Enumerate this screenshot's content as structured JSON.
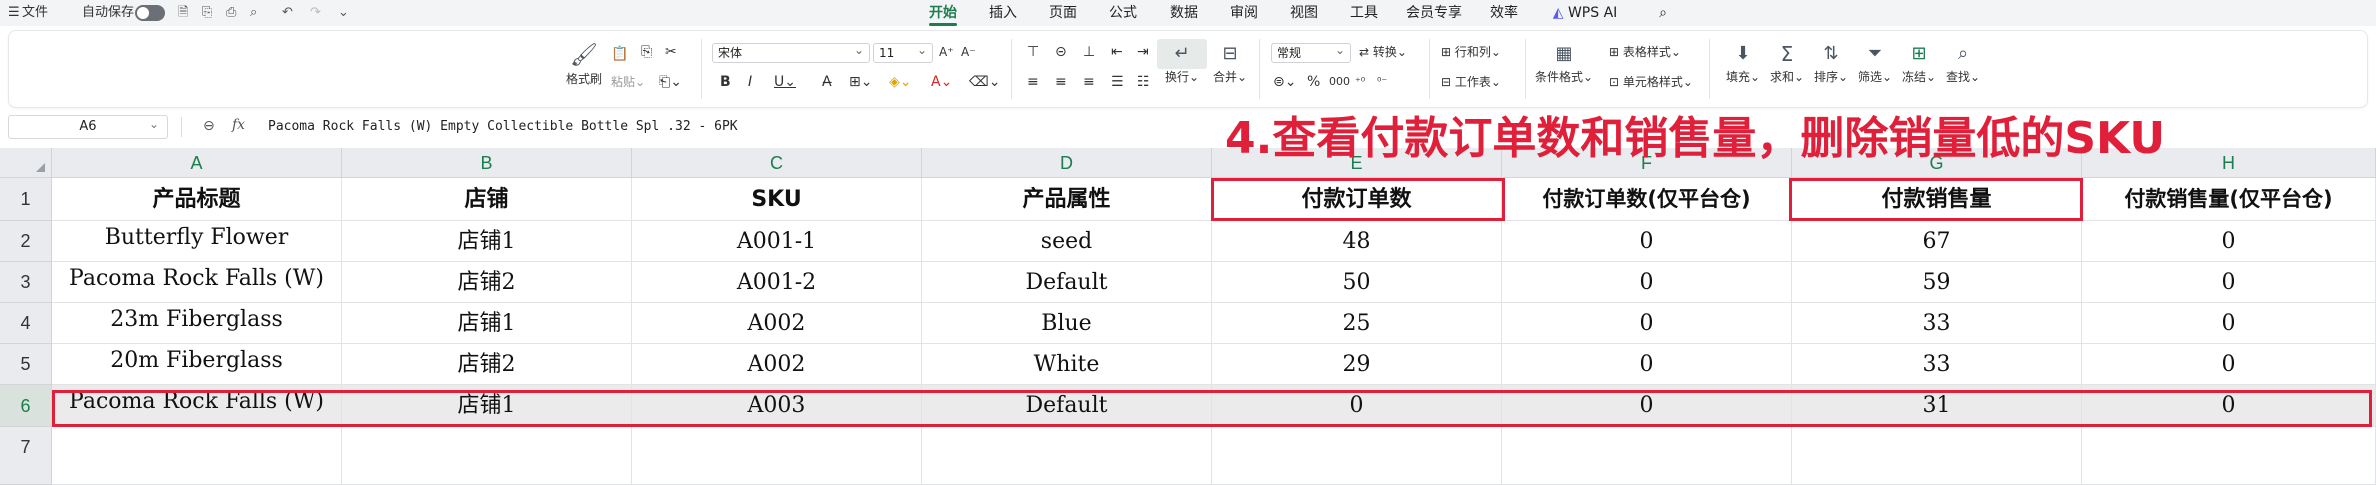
{
  "menubar": {
    "menu_icon": "hamburger-icon",
    "file_label": "文件",
    "autosave_label": "自动保存",
    "tabs": [
      "开始",
      "插入",
      "页面",
      "公式",
      "数据",
      "审阅",
      "视图",
      "工具",
      "会员专享",
      "效率",
      "WPS AI"
    ],
    "active_tab": "开始"
  },
  "ribbon": {
    "format_painter": "格式刷",
    "paste": "粘贴",
    "font_name": "宋体",
    "font_size": "11",
    "wrap_text": "换行",
    "merge": "合并",
    "number_format": "常规",
    "convert": "转换",
    "row_col": "行和列",
    "worksheet": "工作表",
    "conditional_format": "条件格式",
    "table_style": "表格样式",
    "cell_style": "单元格样式",
    "fill": "填充",
    "sum": "求和",
    "sort": "排序",
    "filter": "筛选",
    "freeze": "冻结",
    "find": "查找"
  },
  "formula_bar": {
    "name_box": "A6",
    "fx_label": "fx",
    "content": "Pacoma Rock Falls (W) Empty Collectible Bottle Spl .32 - 6PK"
  },
  "annotation": "4.查看付款订单数和销售量，删除销量低的SKU",
  "sheet": {
    "columns": [
      "A",
      "B",
      "C",
      "D",
      "E",
      "F",
      "G",
      "H"
    ],
    "rows": [
      "1",
      "2",
      "3",
      "4",
      "5",
      "6",
      "7"
    ],
    "selected_row": "6",
    "header": [
      "产品标题",
      "店铺",
      "SKU",
      "产品属性",
      "付款订单数",
      "付款订单数(仅平台仓)",
      "付款销售量",
      "付款销售量(仅平台仓)"
    ],
    "data": [
      [
        "Butterfly Flower",
        "店铺1",
        "A001-1",
        "seed",
        "48",
        "0",
        "67",
        "0"
      ],
      [
        "Pacoma Rock Falls (W)",
        "店铺2",
        "A001-2",
        "Default",
        "50",
        "0",
        "59",
        "0"
      ],
      [
        "23m Fiberglass",
        "店铺1",
        "A002",
        "Blue",
        "25",
        "0",
        "33",
        "0"
      ],
      [
        "20m Fiberglass",
        "店铺2",
        "A002",
        "White",
        "29",
        "0",
        "33",
        "0"
      ],
      [
        "Pacoma Rock Falls (W)",
        "店铺1",
        "A003",
        "Default",
        "0",
        "0",
        "31",
        "0"
      ]
    ]
  },
  "colors": {
    "accent": "#1c7d4f",
    "highlight": "#e0203a"
  }
}
